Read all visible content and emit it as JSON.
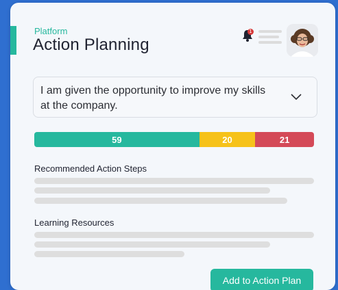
{
  "header": {
    "subtitle": "Platform",
    "title": "Action Planning",
    "notification_count": "1"
  },
  "statement": {
    "text": "I am given the opportunity to improve my skills at the company."
  },
  "results": [
    {
      "label": "59",
      "value": 59,
      "color": "#26b89e"
    },
    {
      "label": "20",
      "value": 20,
      "color": "#f6c21a"
    },
    {
      "label": "21",
      "value": 21,
      "color": "#d44a58"
    }
  ],
  "sections": {
    "action_steps_title": "Recommended Action Steps",
    "learning_resources_title": "Learning Resources"
  },
  "actions": {
    "add_button_label": "Add to Action Plan"
  },
  "icons": {
    "bell": "bell-icon",
    "menu": "menu-lines-icon",
    "chevron": "chevron-down-icon"
  },
  "colors": {
    "accent": "#26b89e",
    "positive": "#26b89e",
    "neutral": "#f6c21a",
    "negative": "#d44a58",
    "badge": "#d63a3a"
  }
}
